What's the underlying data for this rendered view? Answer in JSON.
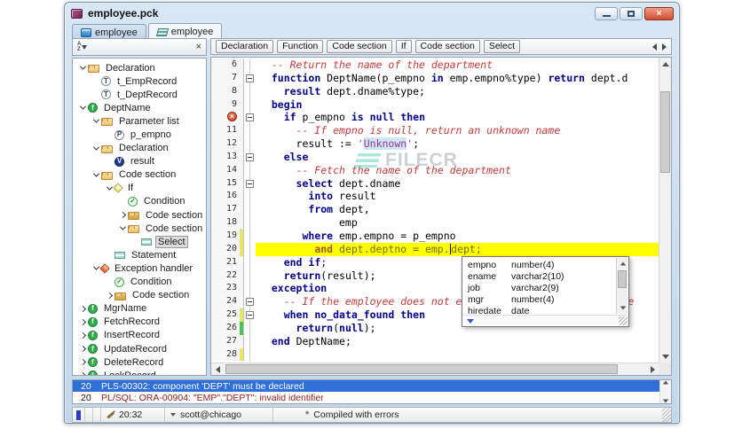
{
  "window": {
    "title": "employee.pck"
  },
  "window_controls": {
    "close_glyph": "×"
  },
  "tabs": [
    {
      "label": "employee",
      "active": false
    },
    {
      "label": "employee",
      "active": true
    }
  ],
  "browser_panel": {
    "close_glyph": "×",
    "sort_letters": [
      "A",
      "Z"
    ]
  },
  "tree": {
    "items": [
      {
        "depth": 0,
        "exp": "v",
        "icon": "folder-open",
        "label": "Declaration"
      },
      {
        "depth": 1,
        "exp": "",
        "icon": "circle-t",
        "label": "t_EmpRecord"
      },
      {
        "depth": 1,
        "exp": "",
        "icon": "circle-t",
        "label": "t_DeptRecord"
      },
      {
        "depth": 0,
        "exp": "v",
        "icon": "func",
        "label": "DeptName"
      },
      {
        "depth": 1,
        "exp": "v",
        "icon": "folder-open",
        "label": "Parameter list"
      },
      {
        "depth": 2,
        "exp": "",
        "icon": "circle-p",
        "label": "p_empno"
      },
      {
        "depth": 1,
        "exp": "v",
        "icon": "folder-open",
        "label": "Declaration"
      },
      {
        "depth": 2,
        "exp": "",
        "icon": "circle-v",
        "label": "result"
      },
      {
        "depth": 1,
        "exp": "v",
        "icon": "folder-open",
        "label": "Code section"
      },
      {
        "depth": 2,
        "exp": "v",
        "icon": "diamond-if",
        "label": "If"
      },
      {
        "depth": 3,
        "exp": "",
        "icon": "check",
        "label": "Condition"
      },
      {
        "depth": 3,
        "exp": "r",
        "icon": "folder-closed",
        "label": "Code section"
      },
      {
        "depth": 3,
        "exp": "v",
        "icon": "folder-open",
        "label": "Code section"
      },
      {
        "depth": 4,
        "exp": "",
        "icon": "stmt",
        "label": "Select",
        "selected": true
      },
      {
        "depth": 2,
        "exp": "",
        "icon": "stmt",
        "label": "Statement"
      },
      {
        "depth": 1,
        "exp": "v",
        "icon": "diamond-exc",
        "label": "Exception handler"
      },
      {
        "depth": 2,
        "exp": "",
        "icon": "check",
        "label": "Condition"
      },
      {
        "depth": 2,
        "exp": "r",
        "icon": "folder-closed",
        "label": "Code section"
      },
      {
        "depth": 0,
        "exp": "r",
        "icon": "func",
        "label": "MgrName"
      },
      {
        "depth": 0,
        "exp": "r",
        "icon": "func",
        "label": "FetchRecord"
      },
      {
        "depth": 0,
        "exp": "r",
        "icon": "func",
        "label": "InsertRecord"
      },
      {
        "depth": 0,
        "exp": "r",
        "icon": "func",
        "label": "UpdateRecord"
      },
      {
        "depth": 0,
        "exp": "r",
        "icon": "func",
        "label": "DeleteRecord"
      },
      {
        "depth": 0,
        "exp": "r",
        "icon": "func",
        "label": "LockRecord"
      }
    ]
  },
  "icon_letters": {
    "circle-t": "T",
    "circle-p": "P",
    "circle-v": "V",
    "func": "f",
    "check": "✓"
  },
  "breadcrumbs": [
    "Declaration",
    "Function",
    "Code section",
    "If",
    "Code section",
    "Select"
  ],
  "editor": {
    "lines": [
      {
        "n": "6",
        "seg": [
          [
            "c",
            "  -- Return the name of the department"
          ]
        ]
      },
      {
        "n": "7",
        "fold": true,
        "seg": [
          [
            "p",
            "  "
          ],
          [
            "k",
            "function"
          ],
          [
            "p",
            " DeptName(p_empno "
          ],
          [
            "k",
            "in"
          ],
          [
            "p",
            " emp.empno%type) "
          ],
          [
            "k",
            "return"
          ],
          [
            "p",
            " dept.d"
          ]
        ]
      },
      {
        "n": "8",
        "seg": [
          [
            "p",
            "    "
          ],
          [
            "k",
            "result"
          ],
          [
            "p",
            " dept.dname%type;"
          ]
        ]
      },
      {
        "n": "9",
        "seg": [
          [
            "p",
            "  "
          ],
          [
            "k",
            "begin"
          ]
        ]
      },
      {
        "n": "10",
        "err": true,
        "fold": true,
        "seg": [
          [
            "p",
            "    "
          ],
          [
            "k",
            "if"
          ],
          [
            "p",
            " p_empno "
          ],
          [
            "k",
            "is"
          ],
          [
            "p",
            " "
          ],
          [
            "k",
            "null"
          ],
          [
            "p",
            " "
          ],
          [
            "k",
            "then"
          ]
        ]
      },
      {
        "n": "11",
        "seg": [
          [
            "c",
            "      -- If empno is null, return an unknown name"
          ]
        ]
      },
      {
        "n": "12",
        "seg": [
          [
            "p",
            "      result := "
          ],
          [
            "s",
            "'"
          ],
          [
            "sh",
            "Unknown"
          ],
          [
            "s",
            "'"
          ],
          [
            "p",
            ";"
          ]
        ]
      },
      {
        "n": "13",
        "fold": true,
        "seg": [
          [
            "p",
            "    "
          ],
          [
            "k",
            "else"
          ]
        ]
      },
      {
        "n": "14",
        "seg": [
          [
            "c",
            "      -- Fetch the name of the department"
          ]
        ]
      },
      {
        "n": "15",
        "fold": true,
        "seg": [
          [
            "p",
            "      "
          ],
          [
            "k",
            "select"
          ],
          [
            "p",
            " dept.dname"
          ]
        ]
      },
      {
        "n": "16",
        "seg": [
          [
            "p",
            "        "
          ],
          [
            "k",
            "into"
          ],
          [
            "p",
            " result"
          ]
        ]
      },
      {
        "n": "17",
        "seg": [
          [
            "p",
            "        "
          ],
          [
            "k",
            "from"
          ],
          [
            "p",
            " dept,"
          ]
        ]
      },
      {
        "n": "18",
        "seg": [
          [
            "p",
            "             emp"
          ]
        ]
      },
      {
        "n": "19",
        "chg": "y",
        "seg": [
          [
            "p",
            "       "
          ],
          [
            "k",
            "where"
          ],
          [
            "p",
            " emp.empno = p_empno"
          ]
        ]
      },
      {
        "n": "20",
        "chg": "y",
        "hl": true,
        "seg": [
          [
            "p2",
            "         "
          ],
          [
            "k2",
            "and"
          ],
          [
            "p2",
            " dept.deptno = emp."
          ],
          [
            "caret",
            ""
          ],
          [
            "p2",
            "dept;"
          ]
        ]
      },
      {
        "n": "21",
        "seg": [
          [
            "p",
            "    "
          ],
          [
            "k",
            "end"
          ],
          [
            "p",
            " "
          ],
          [
            "k",
            "if"
          ],
          [
            "p",
            ";"
          ]
        ]
      },
      {
        "n": "22",
        "seg": [
          [
            "p",
            "    "
          ],
          [
            "k",
            "return"
          ],
          [
            "p",
            "(result);"
          ]
        ]
      },
      {
        "n": "23",
        "seg": [
          [
            "p",
            "  "
          ],
          [
            "k",
            "exception"
          ]
        ]
      },
      {
        "n": "24",
        "fold": true,
        "seg": [
          [
            "c",
            "    -- If the employee does not exist, return an unknown name"
          ]
        ]
      },
      {
        "n": "25",
        "fold": true,
        "chg": "y",
        "seg": [
          [
            "p",
            "    "
          ],
          [
            "k",
            "when"
          ],
          [
            "p",
            " "
          ],
          [
            "k",
            "no_data_found"
          ],
          [
            "p",
            " "
          ],
          [
            "k",
            "then"
          ]
        ]
      },
      {
        "n": "26",
        "chg": "g",
        "seg": [
          [
            "p",
            "      "
          ],
          [
            "k",
            "return"
          ],
          [
            "p",
            "("
          ],
          [
            "k",
            "null"
          ],
          [
            "p",
            ");"
          ]
        ]
      },
      {
        "n": "27",
        "seg": [
          [
            "p",
            "  "
          ],
          [
            "k",
            "end"
          ],
          [
            "p",
            " DeptName;"
          ]
        ]
      },
      {
        "n": "28",
        "chg": "y",
        "seg": []
      }
    ],
    "error_badge_glyph": "×"
  },
  "completion_popup": {
    "items": [
      {
        "name": "empno",
        "type": "number(4)"
      },
      {
        "name": "ename",
        "type": "varchar2(10)"
      },
      {
        "name": "job",
        "type": "varchar2(9)"
      },
      {
        "name": "mgr",
        "type": "number(4)"
      },
      {
        "name": "hiredate",
        "type": "date"
      }
    ]
  },
  "errors": {
    "rows": [
      {
        "line": "20",
        "message": "PLS-00302: component 'DEPT' must be declared",
        "selected": true
      },
      {
        "line": "20",
        "message": "PL/SQL: ORA-00904: \"EMP\".\"DEPT\": invalid identifier",
        "selected": false
      }
    ]
  },
  "status_bar": {
    "position": "20:32",
    "session": "scott@chicago",
    "compile_status": "Compiled with errors",
    "compile_icon_glyph": "*"
  },
  "watermark": "FILECR",
  "colors": {
    "keyword": "#00008b",
    "comment": "#c43b3b",
    "string": "#993399",
    "line_highlight": "#ffff00",
    "selected_row": "#2e6fd8",
    "error_text": "#8b1d1d"
  }
}
